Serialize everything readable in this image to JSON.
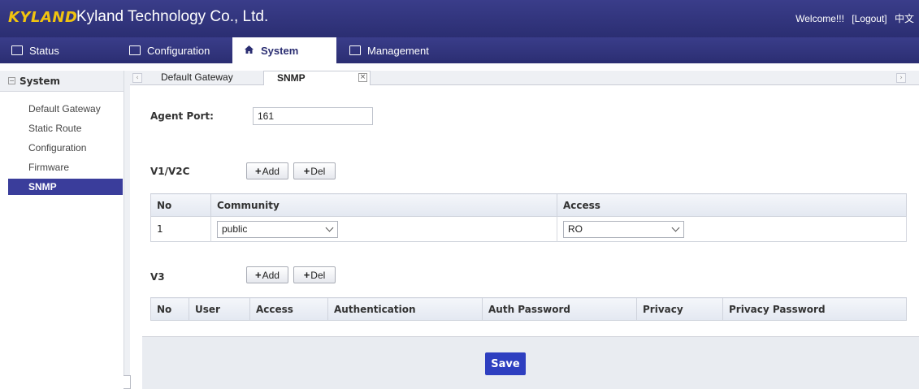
{
  "header": {
    "logo": "KYLAND",
    "company": "Kyland Technology Co., Ltd.",
    "welcome": "Welcome!!!",
    "logout": "[Logout]",
    "language": "中文"
  },
  "nav": {
    "tabs": [
      {
        "label": "Status",
        "icon": "status-icon"
      },
      {
        "label": "Configuration",
        "icon": "configuration-icon"
      },
      {
        "label": "System",
        "icon": "home-icon"
      },
      {
        "label": "Management",
        "icon": "management-icon"
      }
    ],
    "active": "System"
  },
  "sidebar": {
    "heading": "System",
    "collapse_symbol": "−",
    "items": [
      {
        "label": "Default Gateway"
      },
      {
        "label": "Static Route"
      },
      {
        "label": "Configuration"
      },
      {
        "label": "Firmware"
      },
      {
        "label": "SNMP"
      }
    ],
    "active": "SNMP"
  },
  "subtabs": {
    "tabs": [
      {
        "label": "Default Gateway"
      },
      {
        "label": "SNMP"
      }
    ],
    "active": "SNMP",
    "close_symbol": "×"
  },
  "snmp": {
    "agent_port_label": "Agent Port:",
    "agent_port_value": "161",
    "v1v2c": {
      "label": "V1/V2C",
      "add_label": "Add",
      "del_label": "Del",
      "columns": [
        "No",
        "Community",
        "Access"
      ],
      "rows": [
        {
          "no": "1",
          "community": "public",
          "access": "RO"
        }
      ]
    },
    "v3": {
      "label": "V3",
      "add_label": "Add",
      "del_label": "Del",
      "columns": [
        "No",
        "User",
        "Access",
        "Authentication",
        "Auth Password",
        "Privacy",
        "Privacy Password"
      ]
    },
    "save_label": "Save"
  },
  "colors": {
    "header_bg": "#2b2e72",
    "logo": "#f1c40f",
    "active_sidebar": "#3a3d9b",
    "save_button": "#2e3fc0"
  }
}
